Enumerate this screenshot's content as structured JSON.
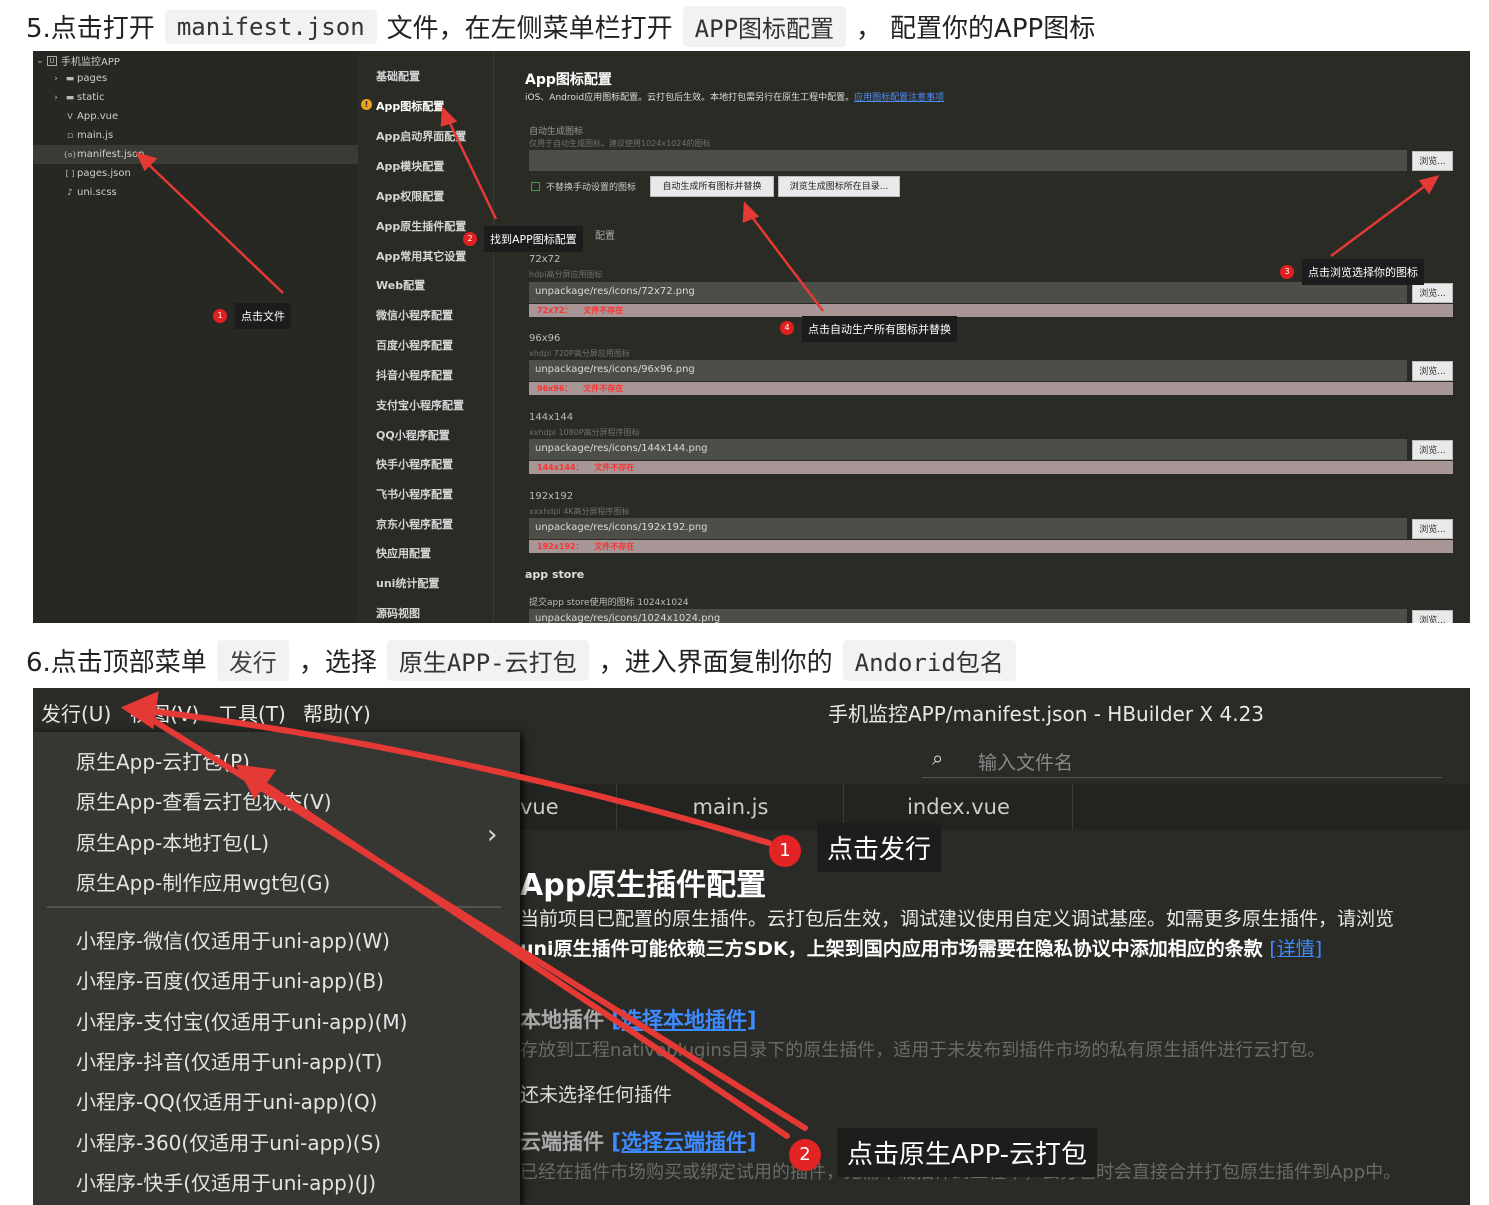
{
  "step5": {
    "prefix": "5.点击打开",
    "code1": "manifest.json",
    "middle": "文件，在左侧菜单栏打开",
    "code2": "APP图标配置",
    "sep": "，",
    "suffix": "配置你的APP图标"
  },
  "shot1": {
    "tree": {
      "root": "手机监控APP",
      "root_toggle": "⌄",
      "root_icon": "U",
      "items": [
        {
          "label": "pages",
          "toggle": "›",
          "icon": "▬"
        },
        {
          "label": "static",
          "toggle": "›",
          "icon": "▬"
        },
        {
          "label": "App.vue",
          "icon": "V"
        },
        {
          "label": "main.js",
          "icon": "▫"
        },
        {
          "label": "manifest.json",
          "icon": "{o}"
        },
        {
          "label": "pages.json",
          "icon": "[ ]"
        },
        {
          "label": "uni.scss",
          "icon": "♪"
        }
      ]
    },
    "nav": [
      "基础配置",
      "App图标配置",
      "App启动界面配置",
      "App模块配置",
      "App权限配置",
      "App原生插件配置",
      "App常用其它设置",
      "Web配置",
      "微信小程序配置",
      "百度小程序配置",
      "抖音小程序配置",
      "支付宝小程序配置",
      "QQ小程序配置",
      "快手小程序配置",
      "飞书小程序配置",
      "京东小程序配置",
      "快应用配置",
      "uni统计配置",
      "源码视图"
    ],
    "warn_icon": "!",
    "config": {
      "title": "App图标配置",
      "desc": "iOS、Android应用图标配置。云打包后生效。本地打包需另行在原生工程中配置。",
      "desc_link": "应用图标配置注意事项",
      "auto_label": "自动生成图标",
      "auto_hint": "仅用于自动生成图标，建议使用1024x1024的图标",
      "browse": "浏览...",
      "checkbox_label": "不替换手动设置的图标",
      "btn_auto": "自动生成所有图标并替换",
      "btn_browse_dir": "浏览生成图标所在目录...",
      "section_android": "配置",
      "icons": [
        {
          "size": "72x72",
          "hint": "hdpi高分屏应用图标",
          "path": "unpackage/res/icons/72x72.png",
          "err_key": "72x72：",
          "err_msg": "文件不存在"
        },
        {
          "size": "96x96",
          "hint": "xhdpi 720P高分屏应用图标",
          "path": "unpackage/res/icons/96x96.png",
          "err_key": "96x96：",
          "err_msg": "文件不存在"
        },
        {
          "size": "144x144",
          "hint": "xxhdpi 1080P高分屏程序图标",
          "path": "unpackage/res/icons/144x144.png",
          "err_key": "144x144：",
          "err_msg": "文件不存在"
        },
        {
          "size": "192x192",
          "hint": "xxxhdpi 4K高分屏程序图标",
          "path": "unpackage/res/icons/192x192.png",
          "err_key": "192x192：",
          "err_msg": "文件不存在"
        }
      ],
      "appstore_label": "app store",
      "appstore_hint": "提交app store使用的图标 1024x1024",
      "appstore_path": "unpackage/res/icons/1024x1024.png"
    },
    "callouts": [
      {
        "num": "1",
        "text": "点击文件"
      },
      {
        "num": "2",
        "text": "找到APP图标配置"
      },
      {
        "num": "3",
        "text": "点击浏览选择你的图标"
      },
      {
        "num": "4",
        "text": "点击自动生产所有图标并替换"
      }
    ],
    "arrow_color": "#e53935"
  },
  "step6": {
    "prefix": "6.点击顶部菜单",
    "code1": "发行",
    "sep1": "，选择",
    "code2": "原生APP-云打包",
    "sep2": "，进入界面复制你的",
    "code3": "Andorid包名"
  },
  "shot2": {
    "menubar": [
      "发行(U)",
      "视图(V)",
      "工具(T)",
      "帮助(Y)"
    ],
    "window_title": "手机监控APP/manifest.json - HBuilder X 4.23",
    "search_placeholder": "输入文件名",
    "tabs": [
      "vue",
      "main.js",
      "index.vue"
    ],
    "dropdown": [
      "原生App-云打包(P)",
      "原生App-查看云打包状态(V)",
      "原生App-本地打包(L)",
      "原生App-制作应用wgt包(G)",
      "小程序-微信(仅适用于uni-app)(W)",
      "小程序-百度(仅适用于uni-app)(B)",
      "小程序-支付宝(仅适用于uni-app)(M)",
      "小程序-抖音(仅适用于uni-app)(T)",
      "小程序-QQ(仅适用于uni-app)(Q)",
      "小程序-360(仅适用于uni-app)(S)",
      "小程序-快手(仅适用于uni-app)(J)"
    ],
    "submenu_chevron": "›",
    "content": {
      "title": "App原生插件配置",
      "line1": "当前项目已配置的原生插件。云打包后生效，调试建议使用自定义调试基座。如需更多原生插件，请浏览",
      "line2": "uni原生插件可能依赖三方SDK，上架到国内应用市场需要在隐私协议中添加相应的条款",
      "line2_link": "[详情]",
      "local_title": "本地插件",
      "local_link": "[选择本地插件]",
      "local_desc": "存放到工程nativeplugins目录下的原生插件，适用于未发布到插件市场的私有原生插件进行云打包。",
      "none": "还未选择任何插件",
      "cloud_title": "云端插件",
      "cloud_link": "[选择云端插件]",
      "cloud_desc": "已经在插件市场购买或绑定试用的插件，无需下载插件到工程中，云打包时会直接合并打包原生插件到App中。"
    },
    "callouts": [
      {
        "num": "1",
        "text": "点击发行"
      },
      {
        "num": "2",
        "text": "点击原生APP-云打包"
      }
    ]
  }
}
